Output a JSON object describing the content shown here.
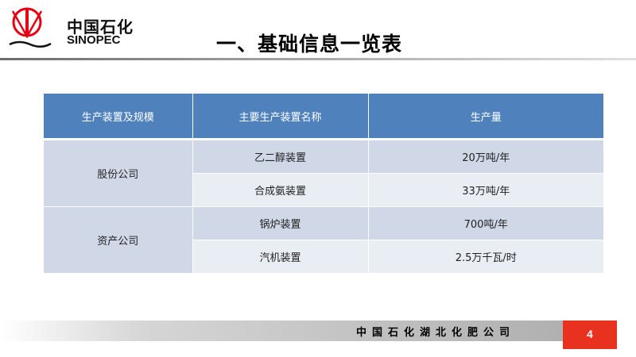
{
  "logo": {
    "cn": "中国石化",
    "en": "SINOPEC"
  },
  "title": "一、基础信息一览表",
  "table": {
    "headers": [
      "生产装置及规模",
      "主要生产装置名称",
      "生产量"
    ],
    "groups": [
      {
        "name": "股份公司",
        "rows": [
          {
            "unit": "乙二醇装置",
            "output": "20万吨/年"
          },
          {
            "unit": "合成氨装置",
            "output": "33万吨/年"
          }
        ]
      },
      {
        "name": "资产公司",
        "rows": [
          {
            "unit": "锅炉装置",
            "output": "700吨/年"
          },
          {
            "unit": "汽机装置",
            "output": "2.5万千瓦/时"
          }
        ]
      }
    ]
  },
  "footer": {
    "company": "中国石化湖北化肥公司",
    "page": "4"
  },
  "colors": {
    "header_bg": "#4f81bd",
    "row_dark": "#d0d8e8",
    "row_light": "#e9edf4",
    "accent": "#e8311f"
  }
}
